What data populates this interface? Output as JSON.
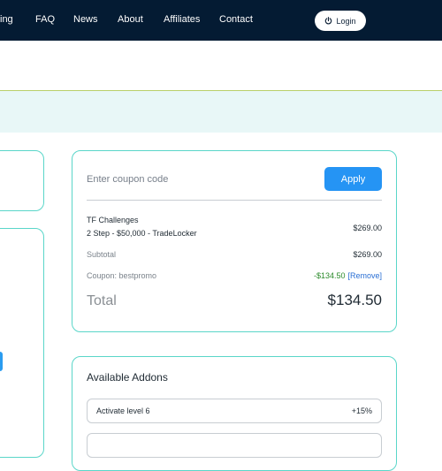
{
  "nav": {
    "items": [
      "ing",
      "FAQ",
      "News",
      "About",
      "Affiliates",
      "Contact"
    ],
    "login_label": "Login"
  },
  "coupon": {
    "placeholder": "Enter coupon code",
    "apply_label": "Apply"
  },
  "order": {
    "item_name": "TF Challenges",
    "item_detail": "2 Step  -  $50,000  -  TradeLocker",
    "item_price": "$269.00",
    "subtotal_label": "Subtotal",
    "subtotal_value": "$269.00",
    "coupon_label": "Coupon: bestpromo",
    "coupon_discount": "-$134.50",
    "coupon_remove": "[Remove]",
    "total_label": "Total",
    "total_value": "$134.50"
  },
  "addons": {
    "title": "Available Addons",
    "items": [
      {
        "name": "Activate level 6",
        "value": "+15%"
      },
      {
        "name": "",
        "value": ""
      }
    ]
  },
  "colors": {
    "nav_bg": "#041b33",
    "accent": "#2594f4",
    "card_border": "#5ad6c9",
    "discount": "#2a8a2a",
    "link": "#2a6fd4"
  },
  "icons": {
    "login": "power-icon"
  }
}
